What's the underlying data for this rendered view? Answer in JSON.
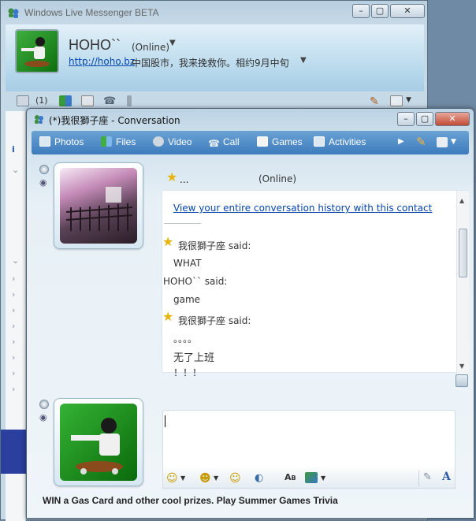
{
  "main_window": {
    "title": "Windows Live Messenger BETA",
    "user": {
      "name": "HOHO``",
      "status": "(Online)",
      "url": "http://hoho.bz",
      "personal_message": "中国股市，我来挽救你。相约9月中旬"
    },
    "toolbar": {
      "mail_count": "(1)"
    }
  },
  "conversation": {
    "title": "(*)我很獅子座 - Conversation",
    "toolbar": {
      "photos": "Photos",
      "files": "Files",
      "video": "Video",
      "call": "Call",
      "games": "Games",
      "activities": "Activities"
    },
    "contact": {
      "name": "...",
      "status": "(Online)"
    },
    "history_link": "View your entire conversation history with this contact",
    "messages": [
      {
        "sender": "我很獅子座 said:",
        "lines": [
          "WHAT"
        ],
        "star": true
      },
      {
        "sender": "HOHO`` said:",
        "lines": [
          "game"
        ],
        "star": false
      },
      {
        "sender": "我很獅子座 said:",
        "lines": [
          "。。。。",
          "无了上班",
          "！！！"
        ],
        "star": true
      }
    ],
    "promo": "WIN a Gas Card and other cool prizes. Play  Summer Games Trivia"
  },
  "colors": {
    "link": "#0645ad",
    "toolbar_blue": "#4a86c4",
    "star": "#e7b40d"
  }
}
